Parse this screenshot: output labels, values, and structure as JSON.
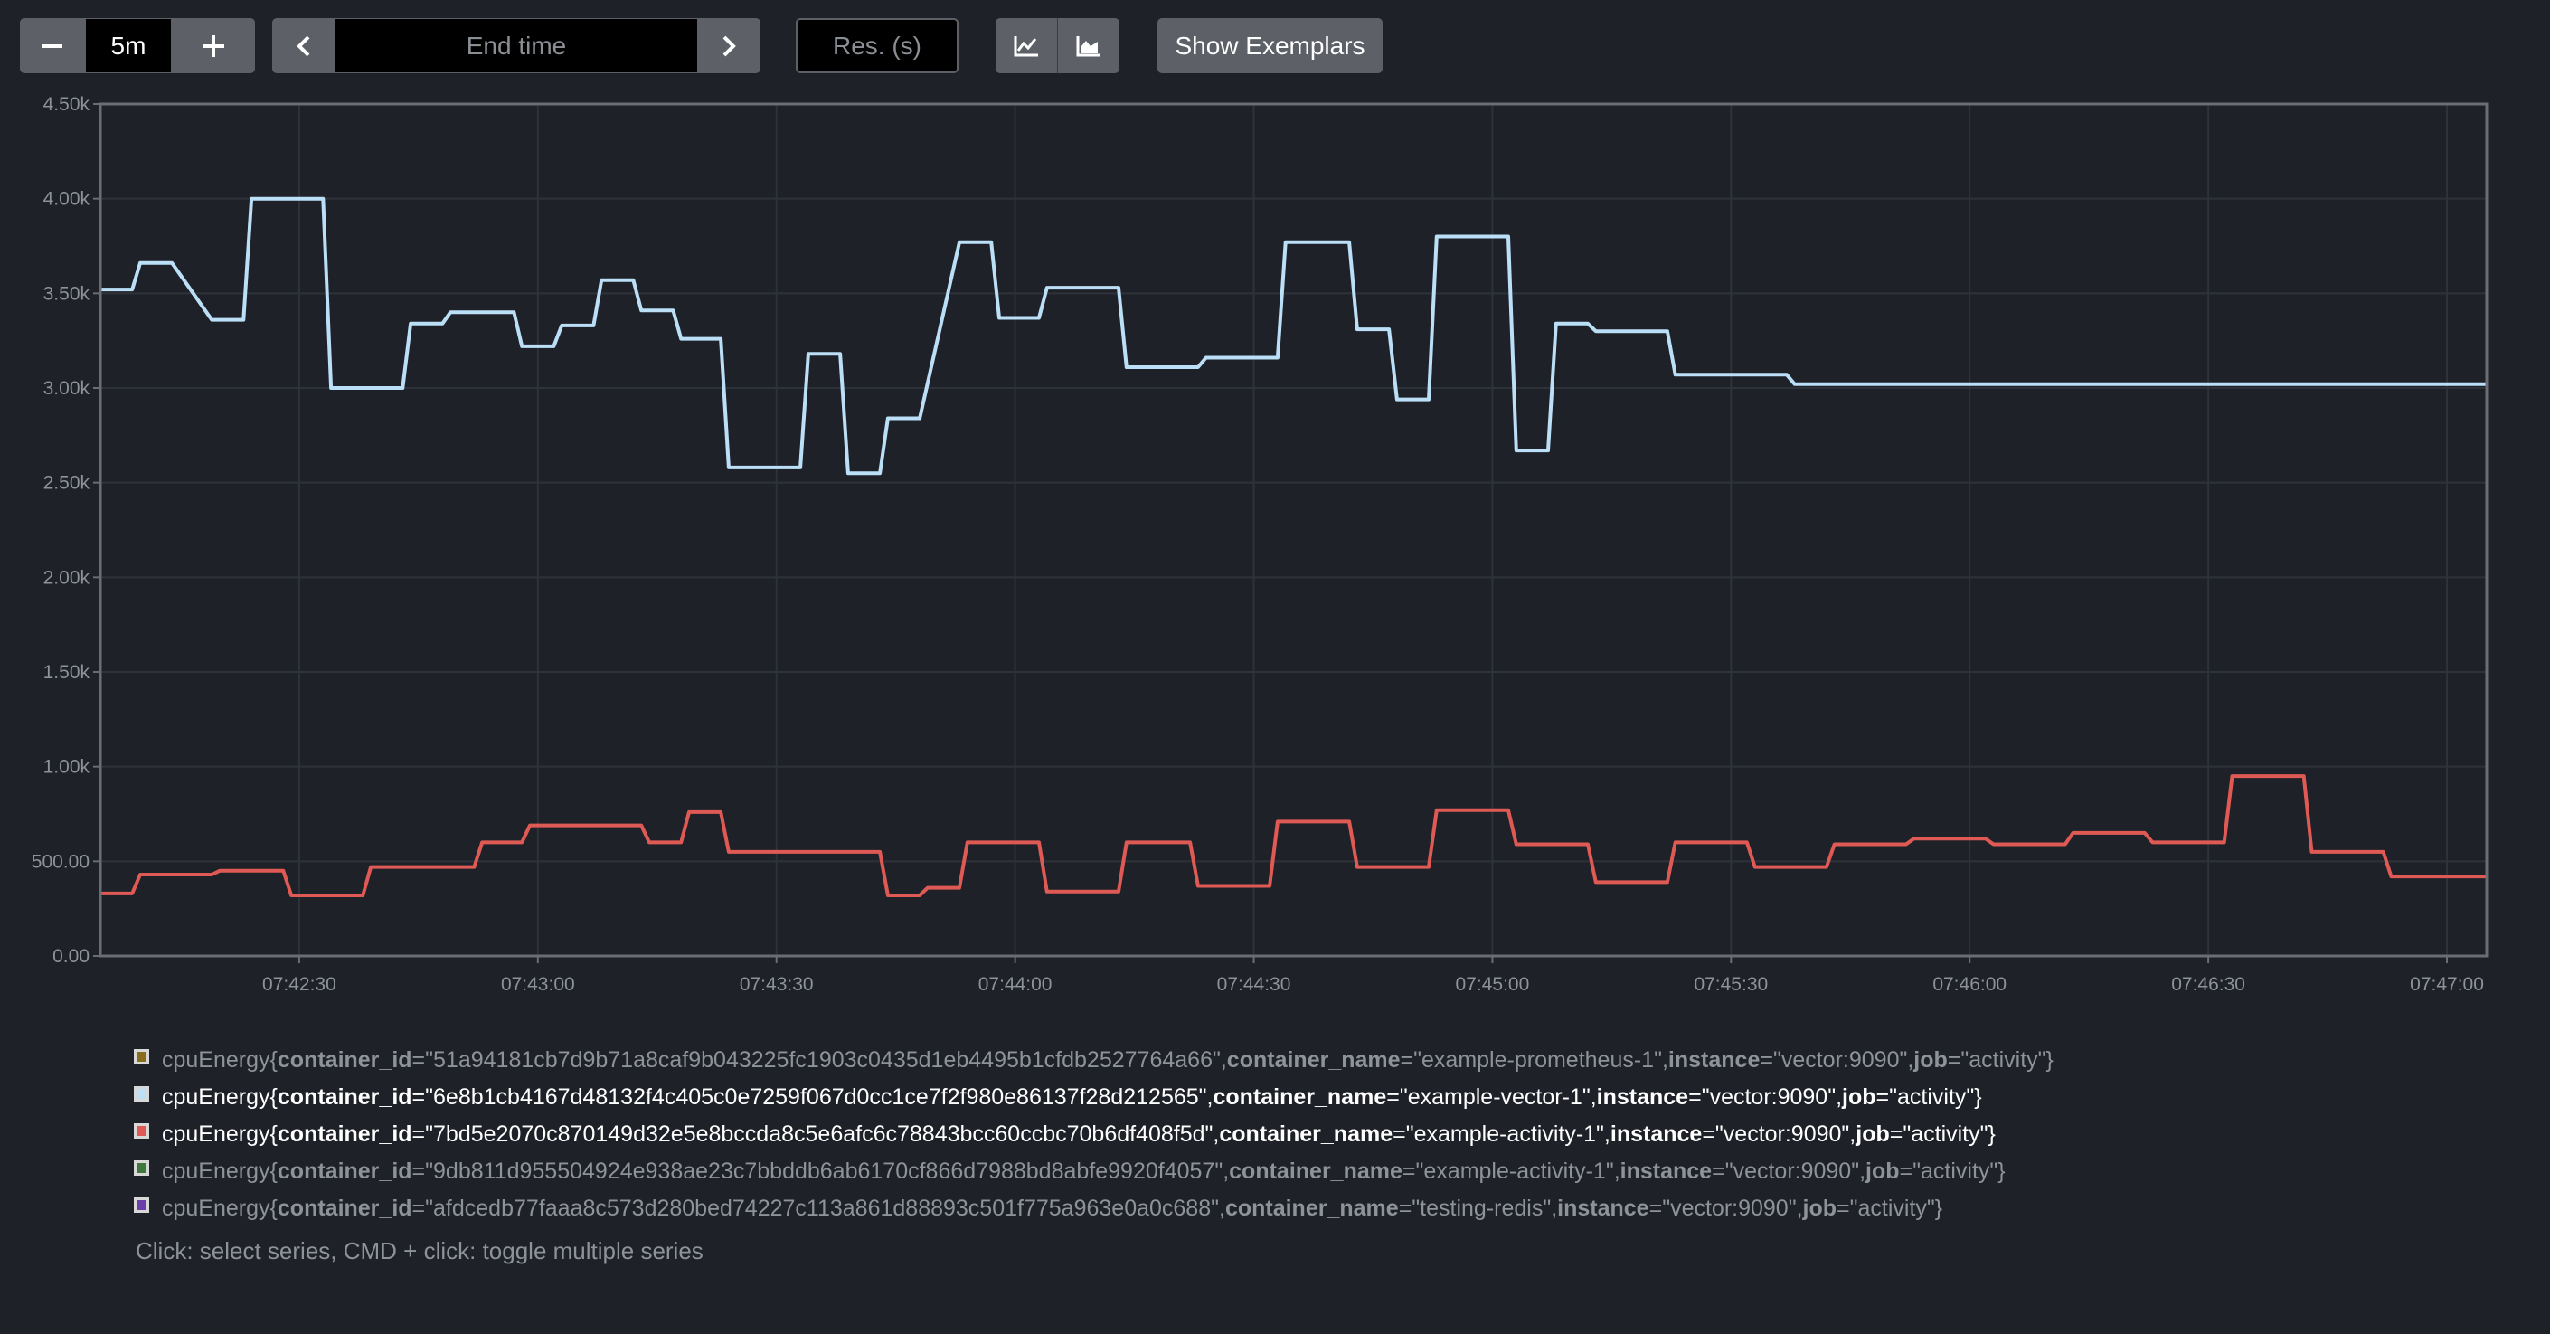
{
  "toolbar": {
    "range_minus_label": "−",
    "range_value": "5m",
    "range_plus_label": "+",
    "prev_icon": "chevron-left-icon",
    "end_time_placeholder": "End time",
    "next_icon": "chevron-right-icon",
    "resolution_placeholder": "Res. (s)",
    "line_chart_icon": "line-chart-icon",
    "stacked_chart_icon": "stacked-chart-icon",
    "exemplars_label": "Show Exemplars"
  },
  "colors": {
    "background": "#1e2127",
    "blue_series": "#bcdff8",
    "red_series": "#e05a55",
    "axis": "#6a6e74",
    "grid": "#2e3239"
  },
  "chart_data": {
    "type": "line",
    "y_tick_labels": [
      "0.00",
      "500.00",
      "1.00k",
      "1.50k",
      "2.00k",
      "2.50k",
      "3.00k",
      "3.50k",
      "4.00k",
      "4.50k"
    ],
    "ylim": [
      0,
      4500
    ],
    "x_tick_labels": [
      "07:42:30",
      "07:43:00",
      "07:43:30",
      "07:44:00",
      "07:44:30",
      "07:45:00",
      "07:45:30",
      "07:46:00",
      "07:46:30",
      "07:47:00"
    ],
    "x_unit": "seconds after 07:42:00",
    "xlim": [
      5,
      305
    ],
    "series": [
      {
        "color": "#bcdff8",
        "x": [
          5,
          9,
          10,
          14,
          19,
          23,
          24,
          33,
          34,
          43,
          44,
          48,
          49,
          57,
          58,
          62,
          63,
          67,
          68,
          72,
          73,
          77,
          78,
          83,
          84,
          93,
          94,
          98,
          99,
          103,
          104,
          108,
          113,
          117,
          118,
          123,
          124,
          133,
          134,
          143,
          144,
          153,
          154,
          162,
          163,
          167,
          168,
          172,
          173,
          182,
          183,
          187,
          188,
          192,
          193,
          202,
          203,
          207,
          208,
          212,
          213,
          217,
          218,
          227,
          228,
          232,
          233,
          247,
          248,
          252,
          253,
          257,
          258,
          262,
          263,
          267,
          268,
          272,
          273,
          277,
          278,
          287,
          288,
          297,
          298,
          300,
          301,
          305
        ],
        "y": [
          3520,
          3520,
          3660,
          3660,
          3360,
          3360,
          4000,
          4000,
          3000,
          3000,
          3340,
          3340,
          3400,
          3400,
          3220,
          3220,
          3330,
          3330,
          3570,
          3570,
          3410,
          3410,
          3260,
          3260,
          2580,
          2580,
          3180,
          3180,
          2550,
          2550,
          2840,
          2840,
          3770,
          3770,
          3370,
          3370,
          3530,
          3530,
          3110,
          3110,
          3160,
          3160,
          3770,
          3770,
          3310,
          3310,
          2940,
          2940,
          3800,
          3800,
          2670,
          2670,
          3340,
          3340,
          3300,
          3300,
          3070,
          3070,
          3070,
          3070,
          3070,
          3070,
          3020,
          3020,
          3020,
          3020,
          3020,
          3020,
          3020,
          3020,
          3020,
          3020,
          3020,
          3020,
          3020,
          3020,
          3020,
          3020,
          3020,
          3020,
          3020,
          3020,
          3020,
          3020,
          3020,
          3020,
          3020,
          3020
        ]
      },
      {
        "color": "#e05a55",
        "x": [
          5,
          9,
          10,
          19,
          20,
          28,
          29,
          38,
          39,
          52,
          53,
          58,
          59,
          73,
          74,
          78,
          79,
          83,
          84,
          103,
          104,
          108,
          109,
          113,
          114,
          123,
          124,
          133,
          134,
          142,
          143,
          152,
          153,
          162,
          163,
          172,
          173,
          182,
          183,
          192,
          193,
          202,
          203,
          212,
          213,
          222,
          223,
          232,
          233,
          242,
          243,
          252,
          253,
          262,
          263,
          272,
          273,
          282,
          283,
          292,
          293,
          300,
          301,
          305
        ],
        "y": [
          330,
          330,
          430,
          430,
          450,
          450,
          320,
          320,
          470,
          470,
          600,
          600,
          690,
          690,
          600,
          600,
          760,
          760,
          550,
          550,
          320,
          320,
          360,
          360,
          600,
          600,
          340,
          340,
          600,
          600,
          370,
          370,
          710,
          710,
          470,
          470,
          770,
          770,
          590,
          590,
          390,
          390,
          600,
          600,
          470,
          470,
          590,
          590,
          620,
          620,
          590,
          590,
          650,
          650,
          600,
          600,
          950,
          950,
          550,
          550,
          420,
          420,
          420,
          420
        ]
      }
    ]
  },
  "legend": {
    "items": [
      {
        "metric": "cpuEnergy",
        "open": "{",
        "k1": "container_id",
        "v1": "=\"51a94181cb7d9b71a8caf9b043225fc1903c0435d1eb4495b1cfdb2527764a66\", ",
        "k2": "container_name",
        "v2": "=\"example-prometheus-1\", ",
        "k3": "instance",
        "v3": "=\"vector:9090\", ",
        "k4": "job",
        "v4": "=\"activity\"}",
        "color": "#8a6d1c"
      },
      {
        "metric": "cpuEnergy",
        "open": "{",
        "k1": "container_id",
        "v1": "=\"6e8b1cb4167d48132f4c405c0e7259f067d0cc1ce7f2f980e86137f28d212565\", ",
        "k2": "container_name",
        "v2": "=\"example-vector-1\", ",
        "k3": "instance",
        "v3": "=\"vector:9090\", ",
        "k4": "job",
        "v4": "=\"activity\"}",
        "color": "#bcdff8"
      },
      {
        "metric": "cpuEnergy",
        "open": "{",
        "k1": "container_id",
        "v1": "=\"7bd5e2070c870149d32e5e8bccda8c5e6afc6c78843bcc60ccbc70b6df408f5d\", ",
        "k2": "container_name",
        "v2": "=\"example-activity-1\", ",
        "k3": "instance",
        "v3": "=\"vector:9090\", ",
        "k4": "job",
        "v4": "=\"activity\"}",
        "color": "#e05a55"
      },
      {
        "metric": "cpuEnergy",
        "open": "{",
        "k1": "container_id",
        "v1": "=\"9db811d955504924e938ae23c7bbddb6ab6170cf866d7988bd8abfe9920f4057\", ",
        "k2": "container_name",
        "v2": "=\"example-activity-1\", ",
        "k3": "instance",
        "v3": "=\"vector:9090\", ",
        "k4": "job",
        "v4": "=\"activity\"}",
        "color": "#3f7a3a"
      },
      {
        "metric": "cpuEnergy",
        "open": "{",
        "k1": "container_id",
        "v1": "=\"afdcedb77faaa8c573d280bed74227c113a861d88893c501f775a963e0a0c688\", ",
        "k2": "container_name",
        "v2": "=\"testing-redis\", ",
        "k3": "instance",
        "v3": "=\"vector:9090\", ",
        "k4": "job",
        "v4": "=\"activity\"}",
        "color": "#6a3fa8"
      }
    ],
    "hint": "Click: select series, CMD + click: toggle multiple series"
  }
}
